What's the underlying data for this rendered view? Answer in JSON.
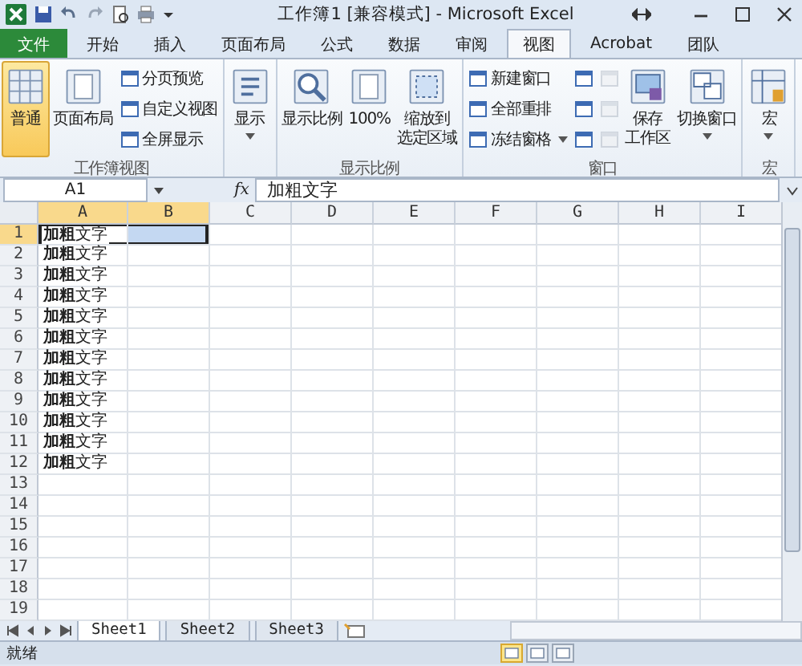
{
  "window": {
    "title": "工作簿1  [兼容模式] - Microsoft Excel"
  },
  "tabs": [
    {
      "label": "文件",
      "kind": "file",
      "selected": false
    },
    {
      "label": "开始",
      "kind": "tab",
      "selected": false
    },
    {
      "label": "插入",
      "kind": "tab",
      "selected": false
    },
    {
      "label": "页面布局",
      "kind": "tab",
      "selected": false
    },
    {
      "label": "公式",
      "kind": "tab",
      "selected": false
    },
    {
      "label": "数据",
      "kind": "tab",
      "selected": false
    },
    {
      "label": "审阅",
      "kind": "tab",
      "selected": false
    },
    {
      "label": "视图",
      "kind": "tab",
      "selected": true
    },
    {
      "label": "Acrobat",
      "kind": "tab",
      "selected": false
    },
    {
      "label": "团队",
      "kind": "tab",
      "selected": false
    }
  ],
  "ribbon": [
    {
      "label": "工作簿视图",
      "items": [
        {
          "kind": "large",
          "lines": [
            "普通"
          ],
          "selected": true
        },
        {
          "kind": "large",
          "lines": [
            "页面布局"
          ],
          "selected": false
        },
        {
          "kind": "stack",
          "children": [
            {
              "label": "分页预览",
              "selected": false
            },
            {
              "label": "自定义视图",
              "selected": false
            },
            {
              "label": "全屏显示",
              "selected": false
            }
          ]
        }
      ]
    },
    {
      "items": [
        {
          "kind": "large",
          "lines": [
            "显示"
          ],
          "dropdown": true
        }
      ]
    },
    {
      "label": "显示比例",
      "items": [
        {
          "kind": "large",
          "lines": [
            "显示比例"
          ]
        },
        {
          "kind": "large",
          "lines": [
            "100%"
          ]
        },
        {
          "kind": "large",
          "lines": [
            "缩放到",
            "选定区域"
          ]
        }
      ]
    },
    {
      "label": "窗口",
      "items": [
        {
          "kind": "stack",
          "children": [
            {
              "label": "新建窗口"
            },
            {
              "label": "全部重排"
            },
            {
              "label": "冻结窗格",
              "dropdown": true
            }
          ]
        },
        {
          "kind": "stack",
          "children": [
            {
              "disabled": false
            },
            {
              "disabled": false
            },
            {
              "disabled": false
            }
          ]
        },
        {
          "kind": "stack",
          "children": [
            {
              "disabled": true
            },
            {
              "disabled": true
            },
            {
              "disabled": true
            }
          ]
        },
        {
          "kind": "large",
          "lines": [
            "保存",
            "工作区"
          ]
        },
        {
          "kind": "large",
          "lines": [
            "切换窗口"
          ],
          "dropdown": true
        }
      ]
    },
    {
      "label": "宏",
      "items": [
        {
          "kind": "large",
          "lines": [
            "宏"
          ],
          "dropdown": true
        }
      ]
    }
  ],
  "formula_bar": {
    "name_box": "A1",
    "fx": "fx",
    "value": "加粗文字"
  },
  "columns": [
    {
      "label": "A",
      "selected": true
    },
    {
      "label": "B",
      "selected": true
    },
    {
      "label": "C",
      "selected": false
    },
    {
      "label": "D",
      "selected": false
    },
    {
      "label": "E",
      "selected": false
    },
    {
      "label": "F",
      "selected": false
    },
    {
      "label": "G",
      "selected": false
    },
    {
      "label": "H",
      "selected": false
    },
    {
      "label": "I",
      "selected": false
    }
  ],
  "rows": [
    {
      "label": "1",
      "selected": true,
      "cells": [
        "**加粗**文字"
      ]
    },
    {
      "label": "2",
      "selected": false,
      "cells": [
        "**加粗**文字"
      ]
    },
    {
      "label": "3",
      "selected": false,
      "cells": [
        "**加粗**文字"
      ]
    },
    {
      "label": "4",
      "selected": false,
      "cells": [
        "**加粗**文字"
      ]
    },
    {
      "label": "5",
      "selected": false,
      "cells": [
        "**加粗**文字"
      ]
    },
    {
      "label": "6",
      "selected": false,
      "cells": [
        "**加粗**文字"
      ]
    },
    {
      "label": "7",
      "selected": false,
      "cells": [
        "**加粗**文字"
      ]
    },
    {
      "label": "8",
      "selected": false,
      "cells": [
        "**加粗**文字"
      ]
    },
    {
      "label": "9",
      "selected": false,
      "cells": [
        "**加粗**文字"
      ]
    },
    {
      "label": "10",
      "selected": false,
      "cells": [
        "**加粗**文字"
      ]
    },
    {
      "label": "11",
      "selected": false,
      "cells": [
        "**加粗**文字"
      ]
    },
    {
      "label": "12",
      "selected": false,
      "cells": [
        "**加粗**文字"
      ]
    },
    {
      "label": "13",
      "selected": false
    },
    {
      "label": "14",
      "selected": false
    },
    {
      "label": "15",
      "selected": false
    },
    {
      "label": "16",
      "selected": false
    },
    {
      "label": "17",
      "selected": false
    },
    {
      "label": "18",
      "selected": false
    },
    {
      "label": "19",
      "selected": false
    }
  ],
  "sheet_tabs": [
    {
      "label": "Sheet1",
      "selected": true
    },
    {
      "label": "Sheet2",
      "selected": false
    },
    {
      "label": "Sheet3",
      "selected": false
    }
  ],
  "status_bar": {
    "text": "就绪",
    "views": [
      {
        "selected": true
      },
      {
        "selected": false
      },
      {
        "selected": false
      }
    ]
  }
}
